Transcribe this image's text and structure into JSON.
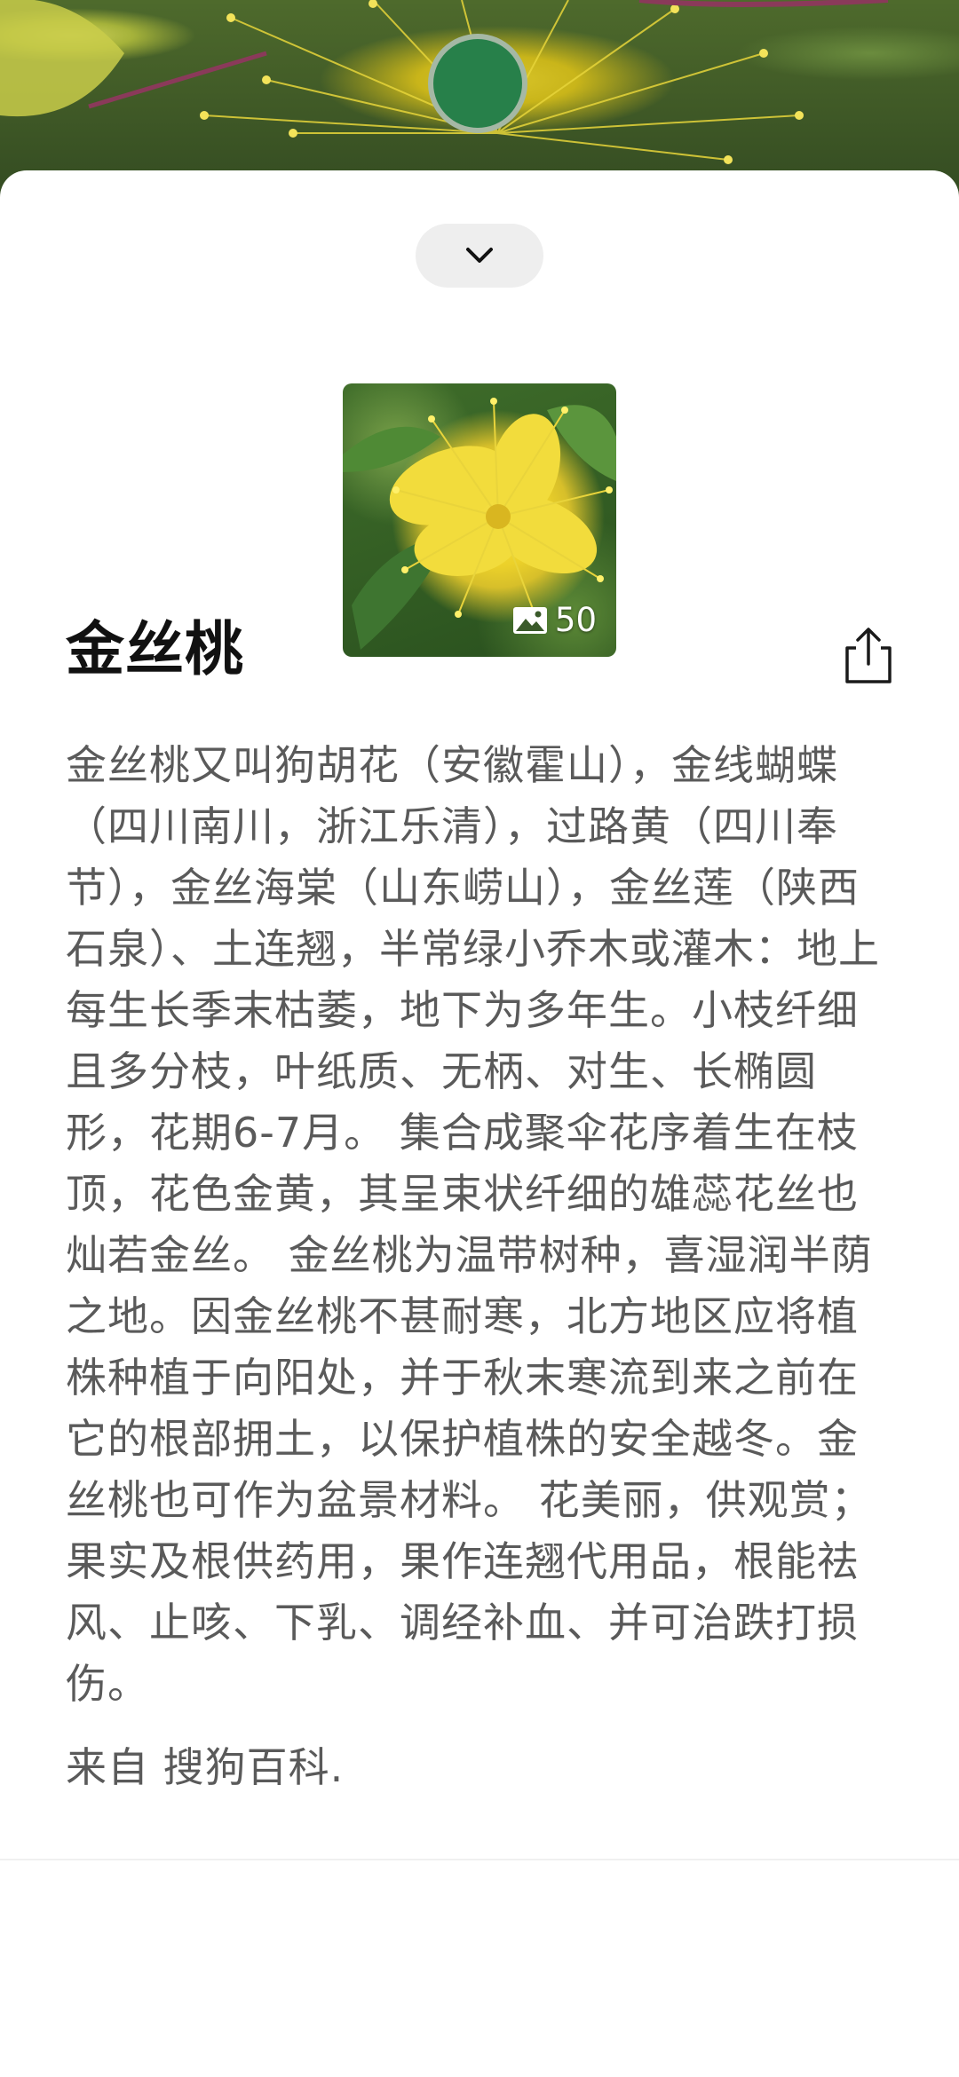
{
  "hero": {
    "capture_button_color": "#27804a"
  },
  "sheet": {
    "collapse_icon": "chevron-down-icon",
    "thumbnail": {
      "gallery_icon": "image-icon",
      "photo_count": "50"
    },
    "title": "金丝桃",
    "share_icon": "share-icon",
    "description": "金丝桃又叫狗胡花（安徽霍山），金线蝴蝶（四川南川，浙江乐清），过路黄（四川奉节），金丝海棠（山东崂山），金丝莲（陕西石泉）、土连翘，半常绿小乔木或灌木：地上每生长季末枯萎，地下为多年生。小枝纤细且多分枝，叶纸质、无柄、对生、长椭圆形，花期6-7月。 集合成聚伞花序着生在枝顶，花色金黄，其呈束状纤细的雄蕊花丝也灿若金丝。 金丝桃为温带树种，喜湿润半荫之地。因金丝桃不甚耐寒，北方地区应将植株种植于向阳处，并于秋末寒流到来之前在它的根部拥土，以保护植株的安全越冬。金丝桃也可作为盆景材料。 花美丽，供观赏；果实及根供药用，果作连翘代用品，根能祛风、止咳、下乳、调经补血、并可治跌打损伤。",
    "source": "来自 搜狗百科."
  }
}
